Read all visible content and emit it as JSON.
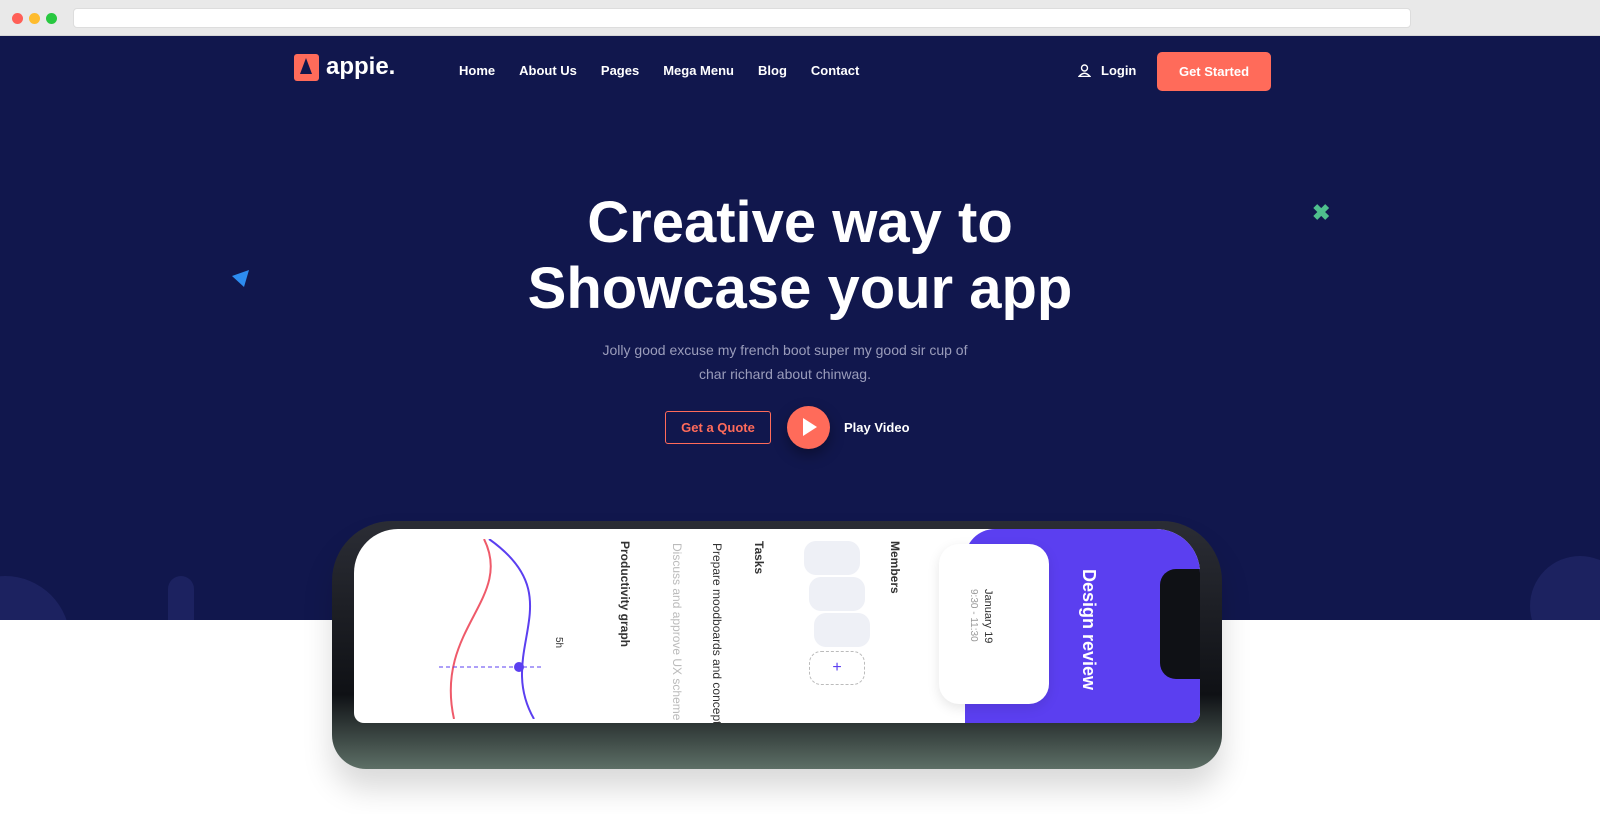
{
  "brand": {
    "name": "appie.",
    "accent": "#ff6b5a",
    "background": "#11174d"
  },
  "nav": {
    "items": [
      "Home",
      "About Us",
      "Pages",
      "Mega Menu",
      "Blog",
      "Contact"
    ]
  },
  "header": {
    "login": "Login",
    "cta": "Get Started"
  },
  "hero": {
    "title_line1": "Creative way to",
    "title_line2": "Showcase your app",
    "subtitle": "Jolly good excuse my french boot super my good sir cup of char richard about chinwag.",
    "quote": "Get a Quote",
    "play": "Play Video"
  },
  "phone": {
    "graph": "Productivity graph",
    "graph_badge": "5h",
    "tasks": "Tasks",
    "task1": "Prepare moodboards and concept",
    "task2": "Discuss and approve UX scheme",
    "members": "Members",
    "event": "Design review",
    "date": "January 19",
    "time": "9:30 - 11:30",
    "add": "+"
  }
}
